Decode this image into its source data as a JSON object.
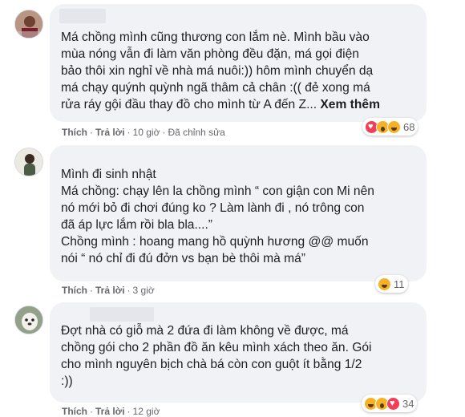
{
  "comments": [
    {
      "text": "Má chồng mình cũng thương con lắm nè. Mình bầu vào\nmùa nóng vẫn đi làm văn phòng đều đặn, má gọi điện\nbảo thôi xin nghỉ về nhà má nuôi:)) hôm mình chuyển dạ\nmá chạy quýnh quỳnh ngã thâm cả chân :(( đẻ xong má\nrửa ráy gội đầu thay đồ cho mình từ A đến Z... ",
      "see_more": "Xem thêm",
      "like": "Thích",
      "reply": "Trả lời",
      "time": "10 giờ",
      "edited": "Đã chỉnh sửa",
      "reaction_icons": [
        "love-icon",
        "wow-icon",
        "haha-icon"
      ],
      "reaction_count": "68"
    },
    {
      "text": "Mình đi sinh nhật\nMá chồng: chạy lên la chồng mình “ con giận con Mi nên\nnó mới bỏ đi chơi đúng ko ? Làm lành đi , nó trông con\nđã áp lực lắm rồi bla bla....”\nChồng mình : hoang mang hồ quỳnh hương @@ muốn\nnói “ nó chỉ đi đú đởn vs bạn bè thôi mà má”",
      "like": "Thích",
      "reply": "Trả lời",
      "time": "3 giờ",
      "reaction_icons": [
        "haha-icon"
      ],
      "reaction_count": "11"
    },
    {
      "text": "Đợt nhà có giỗ mà 2 đứa đi làm không về được, má\nchồng gói cho 2 phần đồ ăn kêu mình xách theo ăn. Gói\ncho mình nguyên bịch chà bá còn con guột ít bằng 1/2\n:))",
      "like": "Thích",
      "reply": "Trả lời",
      "time": "12 giờ",
      "reaction_icons": [
        "haha-icon",
        "wow-icon",
        "love-icon"
      ],
      "reaction_count": "34"
    }
  ],
  "colors": {
    "bubble": "#f0f2f5",
    "meta": "#65676b",
    "text": "#1c1e21"
  }
}
